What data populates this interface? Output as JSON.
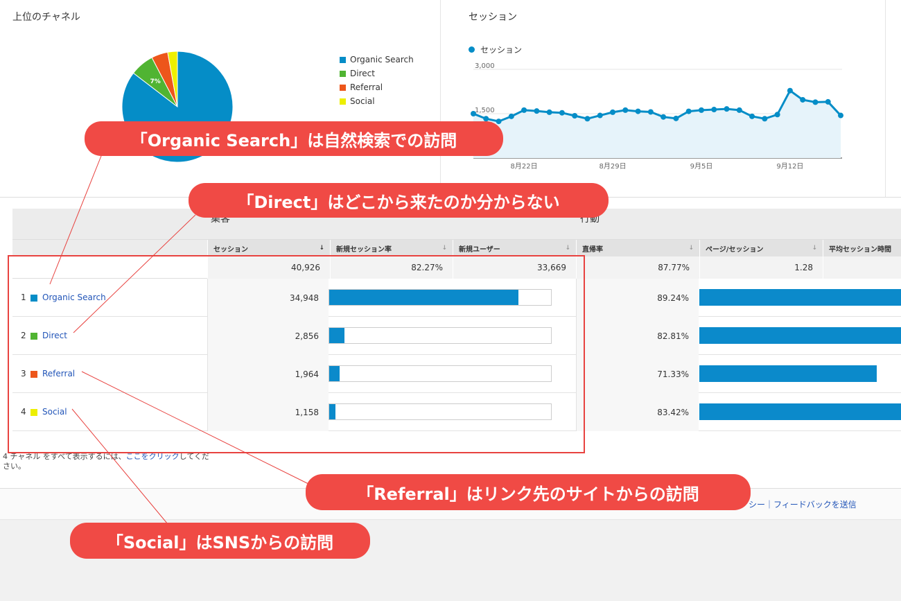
{
  "channels_card": {
    "title": "上位のチャネル",
    "pie_label": "7%",
    "legend": [
      {
        "label": "Organic Search",
        "color": "#058dc7"
      },
      {
        "label": "Direct",
        "color": "#50b432"
      },
      {
        "label": "Referral",
        "color": "#ed561b"
      },
      {
        "label": "Social",
        "color": "#edef00"
      }
    ]
  },
  "sessions_card": {
    "title": "セッション",
    "legend": "セッション",
    "y_ticks": [
      "3,000",
      "1,500"
    ],
    "x_ticks": [
      "8月22日",
      "8月29日",
      "9月5日",
      "9月12日"
    ]
  },
  "chart_data": [
    {
      "type": "pie",
      "categories": [
        "Organic Search",
        "Direct",
        "Referral",
        "Social"
      ],
      "values": [
        34948,
        2856,
        1964,
        1158
      ],
      "colors": [
        "#058dc7",
        "#50b432",
        "#ed561b",
        "#edef00"
      ]
    },
    {
      "type": "line",
      "series": [
        {
          "name": "セッション",
          "values": [
            1500,
            1330,
            1240,
            1410,
            1620,
            1590,
            1550,
            1530,
            1430,
            1330,
            1440,
            1550,
            1620,
            1580,
            1560,
            1390,
            1340,
            1580,
            1620,
            1640,
            1660,
            1620,
            1410,
            1330,
            1470,
            2280,
            1970,
            1890,
            1900,
            1440
          ]
        }
      ],
      "x_ticks": [
        "8月22日",
        "8月29日",
        "9月5日",
        "9月12日"
      ],
      "ylim": [
        0,
        3000
      ],
      "y_ticks": [
        1500,
        3000
      ],
      "color": "#058dc7"
    }
  ],
  "table": {
    "group_acquisition": "集客",
    "group_behavior": "行動",
    "columns": [
      "セッション",
      "新規セッション率",
      "新規ユーザー",
      "直帰率",
      "ページ/セッション",
      "平均セッション時間"
    ],
    "sort_arrow": "↓",
    "dim_arrow": "↓",
    "totals": [
      "40,926",
      "82.27%",
      "33,669",
      "87.77%",
      "1.28"
    ],
    "rows": [
      {
        "num": "1",
        "label": "Organic Search",
        "color": "#058dc7",
        "sessions": "34,948",
        "bounce": "89.24%"
      },
      {
        "num": "2",
        "label": "Direct",
        "color": "#50b432",
        "sessions": "2,856",
        "bounce": "82.81%"
      },
      {
        "num": "3",
        "label": "Referral",
        "color": "#ed561b",
        "sessions": "1,964",
        "bounce": "71.33%"
      },
      {
        "num": "4",
        "label": "Social",
        "color": "#edef00",
        "sessions": "1,158",
        "bounce": "83.42%"
      }
    ],
    "session_share": [
      0.854,
      0.07,
      0.048,
      0.028
    ],
    "bounce_share": [
      1.0,
      1.0,
      0.88,
      1.0
    ]
  },
  "footnote": {
    "prefix": "4 チャネル をすべて表示するには、",
    "link": "ここをクリック",
    "suffix": "してください。"
  },
  "footer_links": "シー｜フィードバックを送信",
  "callouts": {
    "organic": "「Organic Search」は自然検索での訪問",
    "direct": "「Direct」はどこから来たのか分からない",
    "referral": "「Referral」はリンク先のサイトからの訪問",
    "social": "「Social」はSNSからの訪問"
  }
}
